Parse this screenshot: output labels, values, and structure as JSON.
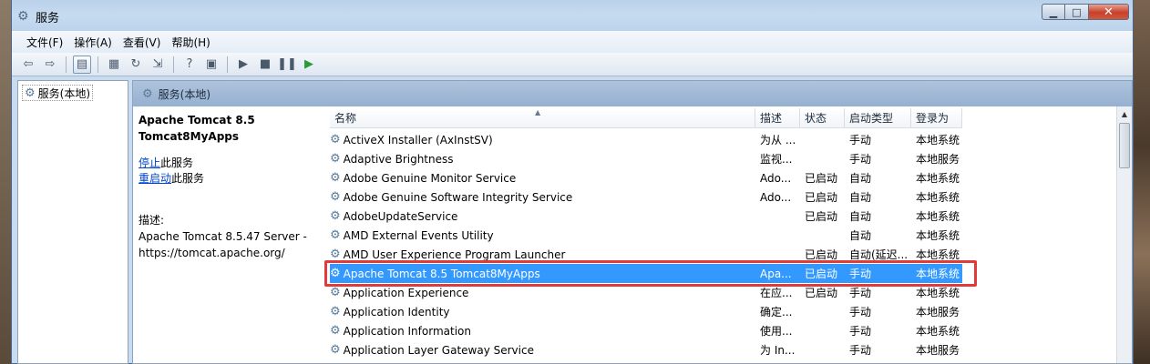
{
  "window": {
    "title": "服务"
  },
  "menu": [
    "文件(F)",
    "操作(A)",
    "查看(V)",
    "帮助(H)"
  ],
  "tree": {
    "root_label": "服务(本地)"
  },
  "pane": {
    "header": "服务(本地)"
  },
  "detail": {
    "name_line1": "Apache Tomcat 8.5",
    "name_line2": "Tomcat8MyApps",
    "stop_link": "停止",
    "stop_suffix": "此服务",
    "restart_link": "重启动",
    "restart_suffix": "此服务",
    "desc_label": "描述:",
    "desc_line1": "Apache Tomcat 8.5.47 Server -",
    "desc_line2": "https://tomcat.apache.org/"
  },
  "columns": [
    "名称",
    "描述",
    "状态",
    "启动类型",
    "登录为"
  ],
  "rows": [
    {
      "name": "ActiveX Installer (AxInstSV)",
      "desc": "为从 ...",
      "status": "",
      "startup": "手动",
      "logon": "本地系统"
    },
    {
      "name": "Adaptive Brightness",
      "desc": "监视...",
      "status": "",
      "startup": "手动",
      "logon": "本地服务"
    },
    {
      "name": "Adobe Genuine Monitor Service",
      "desc": "Ado...",
      "status": "已启动",
      "startup": "自动",
      "logon": "本地系统"
    },
    {
      "name": "Adobe Genuine Software Integrity Service",
      "desc": "Ado...",
      "status": "已启动",
      "startup": "自动",
      "logon": "本地系统"
    },
    {
      "name": "AdobeUpdateService",
      "desc": "",
      "status": "已启动",
      "startup": "自动",
      "logon": "本地系统"
    },
    {
      "name": "AMD External Events Utility",
      "desc": "",
      "status": "",
      "startup": "自动",
      "logon": "本地系统"
    },
    {
      "name": "AMD User Experience Program Launcher",
      "desc": "",
      "status": "已启动",
      "startup": "自动(延迟...",
      "logon": "本地系统"
    },
    {
      "name": "Apache Tomcat 8.5 Tomcat8MyApps",
      "desc": "Apa...",
      "status": "已启动",
      "startup": "手动",
      "logon": "本地系统",
      "selected": true
    },
    {
      "name": "Application Experience",
      "desc": "在应...",
      "status": "已启动",
      "startup": "手动",
      "logon": "本地系统"
    },
    {
      "name": "Application Identity",
      "desc": "确定...",
      "status": "",
      "startup": "手动",
      "logon": "本地服务"
    },
    {
      "name": "Application Information",
      "desc": "使用...",
      "status": "",
      "startup": "手动",
      "logon": "本地系统"
    },
    {
      "name": "Application Layer Gateway Service",
      "desc": "为 In...",
      "status": "",
      "startup": "手动",
      "logon": "本地服务"
    }
  ],
  "colors": {
    "selection": "#3399ff",
    "highlight_border": "#e03a3a"
  }
}
